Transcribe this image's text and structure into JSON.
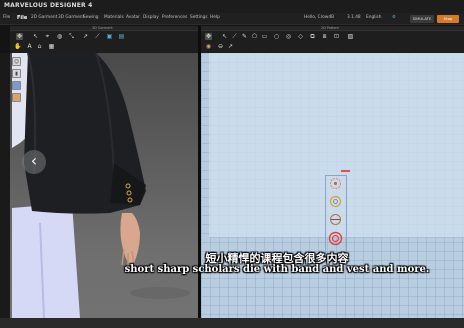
{
  "app": {
    "title": "MARVELOUS DESIGNER 4"
  },
  "menu": {
    "items": [
      "File",
      "2D Garment",
      "3D Garment",
      "Sewing",
      "Materials",
      "Avatar",
      "Display",
      "Preferences",
      "Settings",
      "Help"
    ],
    "active": "File"
  },
  "header": {
    "user": "Hello, CrowdB",
    "version": "3.1.48",
    "lang": "English",
    "btn_a": "SIMULATE",
    "btn_b": "Stop"
  },
  "panels": {
    "left_label": "3D Garment",
    "right_label": "2D Pattern"
  },
  "subtitles": {
    "chinese": "短小精悍的课程包含很多内容",
    "english": "short sharp scholars die with band and vest and more."
  },
  "colors": {
    "accent": "#d47a2a",
    "grid_bg": "#b9cde0",
    "viewport_bg": "#5d5d5d"
  }
}
